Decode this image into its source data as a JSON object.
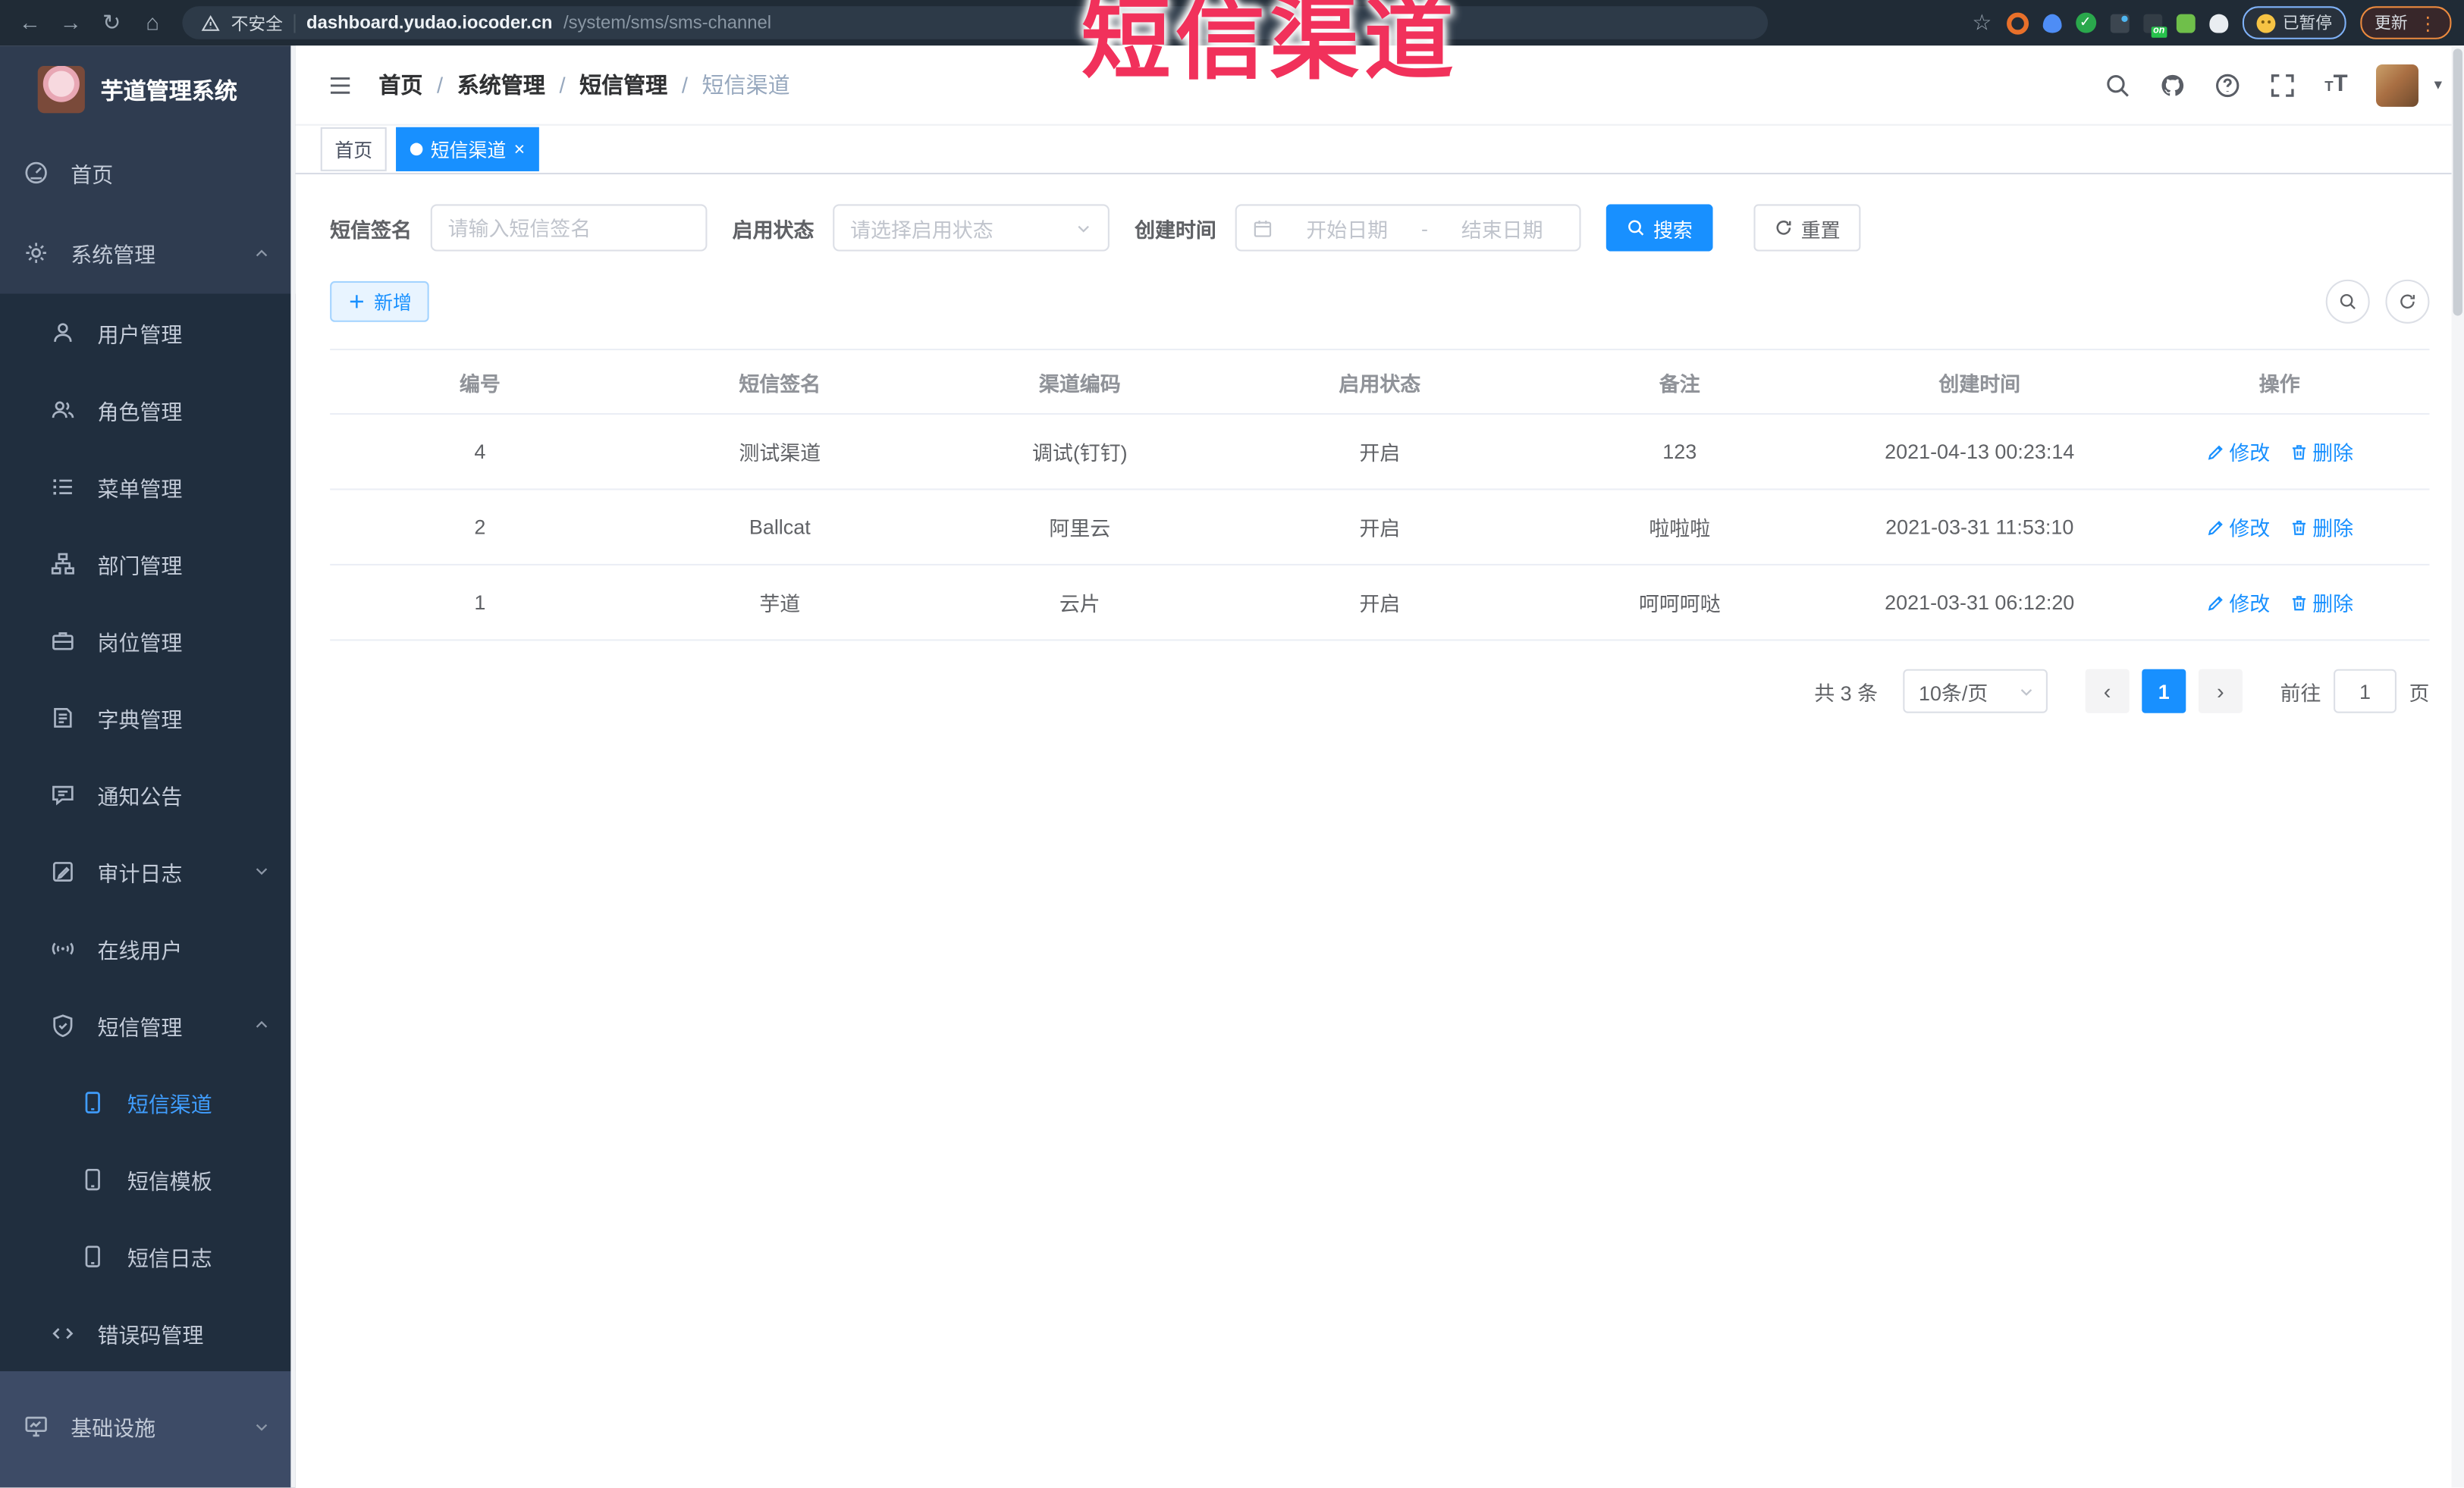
{
  "colors": {
    "accent": "#1890ff",
    "menu_active": "#409eff",
    "annotation": "#f1315b",
    "sidebar_bg": "#2f3c50",
    "submenu_bg": "#202e3e"
  },
  "annotation": {
    "text": "短信渠道"
  },
  "browser": {
    "security_label": "不安全",
    "url_domain": "dashboard.yudao.iocoder.cn",
    "url_path": "/system/sms/sms-channel",
    "extension_on_badge": "on",
    "paused_label": "已暂停",
    "update_label": "更新"
  },
  "sidebar": {
    "title": "芋道管理系统",
    "items": [
      {
        "label": "首页"
      },
      {
        "label": "系统管理"
      },
      {
        "label": "用户管理"
      },
      {
        "label": "角色管理"
      },
      {
        "label": "菜单管理"
      },
      {
        "label": "部门管理"
      },
      {
        "label": "岗位管理"
      },
      {
        "label": "字典管理"
      },
      {
        "label": "通知公告"
      },
      {
        "label": "审计日志"
      },
      {
        "label": "在线用户"
      },
      {
        "label": "短信管理"
      },
      {
        "label": "短信渠道"
      },
      {
        "label": "短信模板"
      },
      {
        "label": "短信日志"
      },
      {
        "label": "错误码管理"
      },
      {
        "label": "基础设施"
      }
    ]
  },
  "breadcrumb": {
    "items": [
      "首页",
      "系统管理",
      "短信管理",
      "短信渠道"
    ]
  },
  "tabs": [
    {
      "label": "首页"
    },
    {
      "label": "短信渠道"
    }
  ],
  "filters": {
    "sign_label": "短信签名",
    "sign_placeholder": "请输入短信签名",
    "status_label": "启用状态",
    "status_placeholder": "请选择启用状态",
    "time_label": "创建时间",
    "start_placeholder": "开始日期",
    "range_separator": "-",
    "end_placeholder": "结束日期",
    "search_label": "搜索",
    "reset_label": "重置"
  },
  "toolbar": {
    "add_label": "新增"
  },
  "table": {
    "columns": [
      "编号",
      "短信签名",
      "渠道编码",
      "启用状态",
      "备注",
      "创建时间",
      "操作"
    ],
    "actions": {
      "edit": "修改",
      "delete": "删除"
    },
    "rows": [
      {
        "id": "4",
        "sign": "测试渠道",
        "code": "调试(钉钉)",
        "status": "开启",
        "remark": "123",
        "created": "2021-04-13 00:23:14"
      },
      {
        "id": "2",
        "sign": "Ballcat",
        "code": "阿里云",
        "status": "开启",
        "remark": "啦啦啦",
        "created": "2021-03-31 11:53:10"
      },
      {
        "id": "1",
        "sign": "芋道",
        "code": "云片",
        "status": "开启",
        "remark": "呵呵呵哒",
        "created": "2021-03-31 06:12:20"
      }
    ]
  },
  "pagination": {
    "total": "共 3 条",
    "page_size": "10条/页",
    "current_page": "1",
    "goto_label": "前往",
    "goto_value": "1",
    "page_unit": "页"
  }
}
